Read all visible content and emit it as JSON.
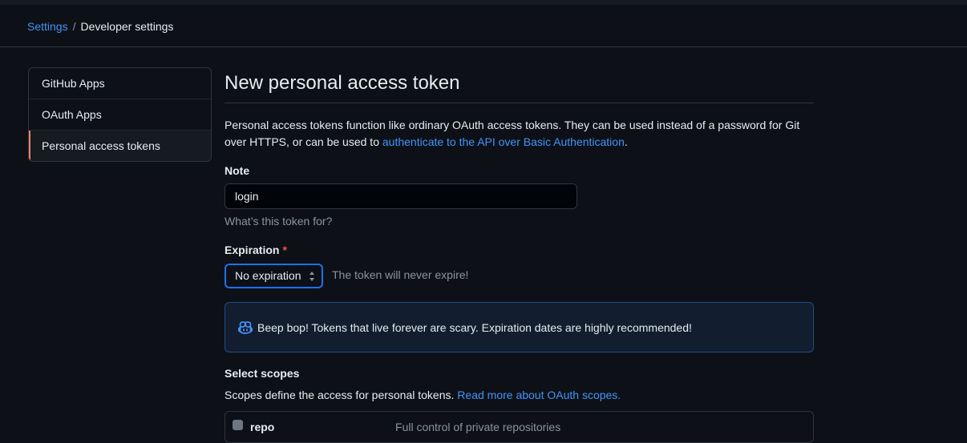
{
  "breadcrumb": {
    "parent": "Settings",
    "separator": "/",
    "current": "Developer settings"
  },
  "sidebar": {
    "items": [
      {
        "label": "GitHub Apps",
        "active": false
      },
      {
        "label": "OAuth Apps",
        "active": false
      },
      {
        "label": "Personal access tokens",
        "active": true
      }
    ]
  },
  "page": {
    "title": "New personal access token",
    "description_prefix": "Personal access tokens function like ordinary OAuth access tokens. They can be used instead of a password for Git over HTTPS, or can be used to ",
    "description_link": "authenticate to the API over Basic Authentication",
    "description_suffix": "."
  },
  "note": {
    "label": "Note",
    "value": "login",
    "hint": "What’s this token for?"
  },
  "expiration": {
    "label": "Expiration",
    "required_marker": "*",
    "selected": "No expiration",
    "note": "The token will never expire!"
  },
  "flash": {
    "icon": "copilot-icon",
    "text": "Beep bop! Tokens that live forever are scary. Expiration dates are highly recommended!"
  },
  "scopes": {
    "heading": "Select scopes",
    "description": "Scopes define the access for personal tokens.",
    "link": "Read more about OAuth scopes.",
    "items": [
      {
        "name": "repo",
        "description": "Full control of private repositories",
        "checked": false
      }
    ]
  },
  "colors": {
    "background": "#0d1117",
    "accent_link": "#4493f8",
    "active_marker": "#f78166",
    "focus_border": "#1f6feb",
    "required": "#f85149"
  }
}
